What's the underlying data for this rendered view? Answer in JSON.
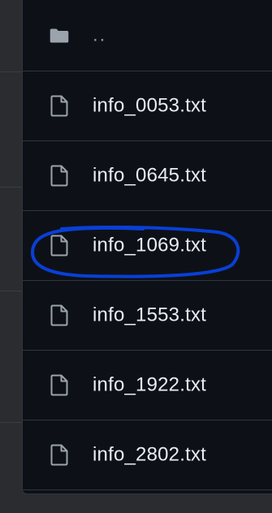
{
  "parent_entry": {
    "icon": "folder-icon",
    "label": ".."
  },
  "files": [
    {
      "icon": "file-icon",
      "name": "info_0053.txt"
    },
    {
      "icon": "file-icon",
      "name": "info_0645.txt"
    },
    {
      "icon": "file-icon",
      "name": "info_1069.txt",
      "annotated": true
    },
    {
      "icon": "file-icon",
      "name": "info_1553.txt"
    },
    {
      "icon": "file-icon",
      "name": "info_1922.txt"
    },
    {
      "icon": "file-icon",
      "name": "info_2802.txt"
    }
  ],
  "colors": {
    "panel_bg": "#0d1117",
    "border": "#30363d",
    "text": "#e6edf3",
    "muted": "#8b949e",
    "annotation": "#0a3fd6"
  }
}
